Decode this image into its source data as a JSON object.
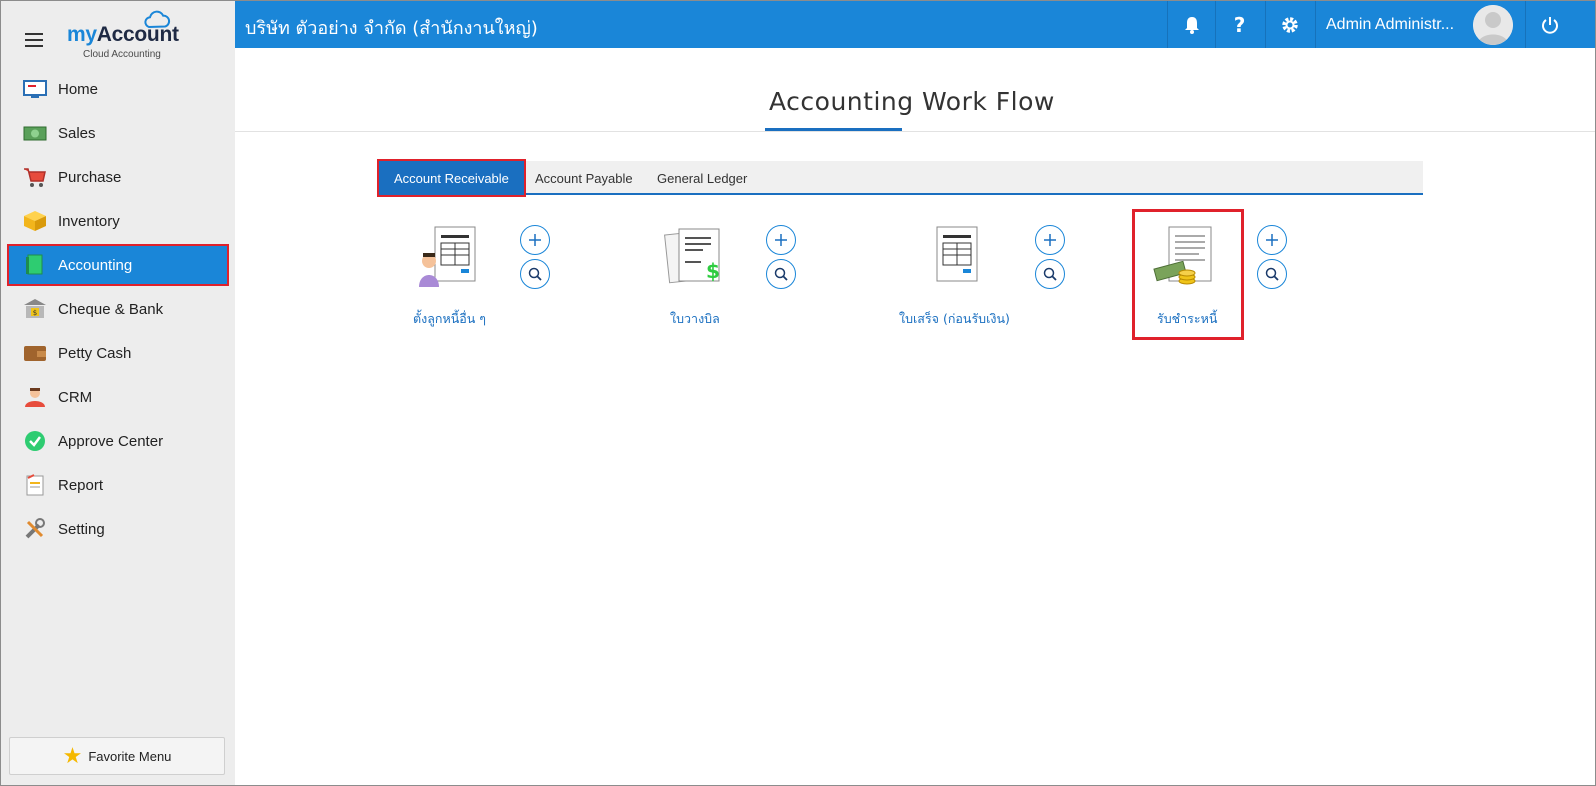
{
  "brand": {
    "name_part1": "my",
    "name_part2": "Account",
    "subtitle": "Cloud Accounting"
  },
  "sidebar": {
    "items": [
      {
        "label": "Home",
        "icon": "home-icon"
      },
      {
        "label": "Sales",
        "icon": "sales-icon"
      },
      {
        "label": "Purchase",
        "icon": "cart-icon"
      },
      {
        "label": "Inventory",
        "icon": "box-icon"
      },
      {
        "label": "Accounting",
        "icon": "book-icon",
        "active": true
      },
      {
        "label": "Cheque & Bank",
        "icon": "bank-icon"
      },
      {
        "label": "Petty Cash",
        "icon": "wallet-icon"
      },
      {
        "label": "CRM",
        "icon": "people-icon"
      },
      {
        "label": "Approve Center",
        "icon": "check-icon"
      },
      {
        "label": "Report",
        "icon": "report-icon"
      },
      {
        "label": "Setting",
        "icon": "tools-icon"
      }
    ],
    "favorite_label": "Favorite Menu"
  },
  "header": {
    "company": "บริษัท ตัวอย่าง จำกัด (สำนักงานใหญ่)",
    "user": "Admin Administr...",
    "accent": "#1a86d8"
  },
  "main": {
    "title": "Accounting Work Flow",
    "tabs": [
      {
        "label": "Account Receivable",
        "active": true
      },
      {
        "label": "Account Payable"
      },
      {
        "label": "General Ledger"
      }
    ],
    "workflow": [
      {
        "label": "ตั้งลูกหนี้อื่น ๆ",
        "icon": "invoice-person-icon"
      },
      {
        "label": "ใบวางบิล",
        "icon": "billing-note-icon"
      },
      {
        "label": "ใบเสร็จ (ก่อนรับเงิน)",
        "icon": "receipt-icon"
      },
      {
        "label": "รับชำระหนี้",
        "icon": "payment-received-icon",
        "highlighted": true
      }
    ]
  }
}
